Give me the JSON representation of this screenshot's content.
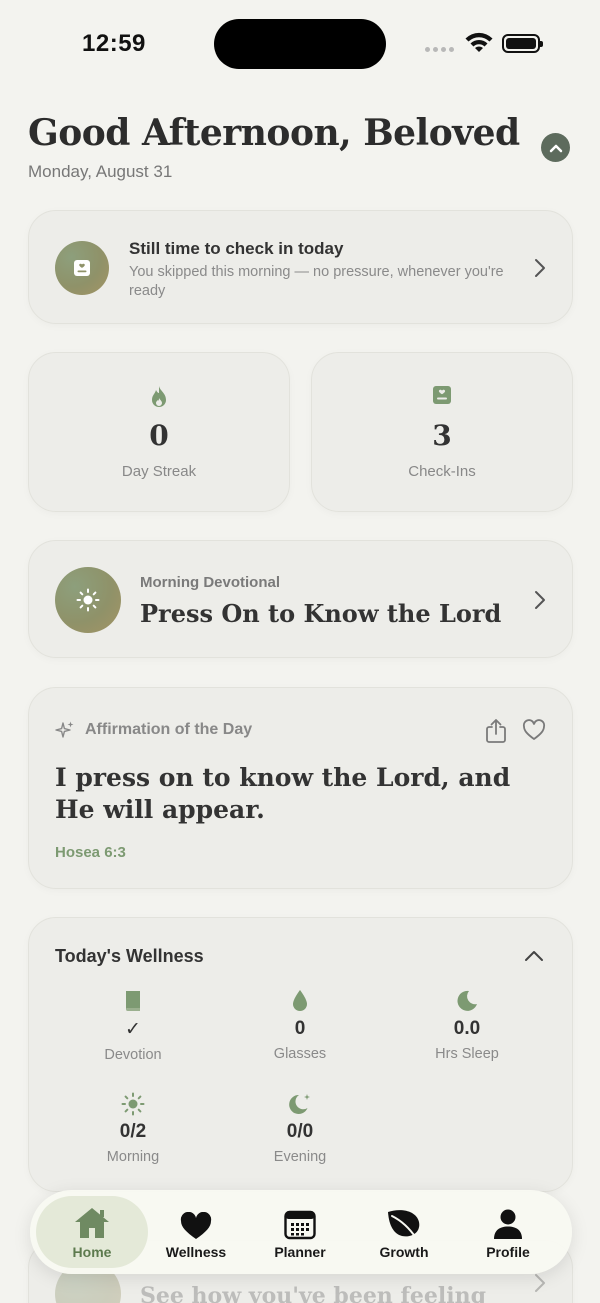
{
  "status_bar": {
    "time": "12:59"
  },
  "header": {
    "greeting": "Good Afternoon, Beloved",
    "date": "Monday, August 31"
  },
  "checkin_card": {
    "title": "Still time to check in today",
    "subtitle": "You skipped this morning — no pressure, whenever you're ready"
  },
  "stats": [
    {
      "value": "0",
      "label": "Day Streak",
      "icon": "flame-icon"
    },
    {
      "value": "3",
      "label": "Check-Ins",
      "icon": "journal-icon"
    }
  ],
  "devotional": {
    "label": "Morning Devotional",
    "title": "Press On to Know the Lord"
  },
  "affirmation": {
    "label": "Affirmation of the Day",
    "text": "I press on to know the Lord, and He will appear.",
    "reference": "Hosea 6:3"
  },
  "wellness": {
    "title": "Today's Wellness",
    "metrics": [
      {
        "value": "✓",
        "label": "Devotion",
        "icon": "book-icon"
      },
      {
        "value": "0",
        "label": "Glasses",
        "icon": "water-drop-icon"
      },
      {
        "value": "0.0",
        "label": "Hrs Sleep",
        "icon": "moon-icon"
      },
      {
        "value": "0/2",
        "label": "Morning",
        "icon": "sun-icon"
      },
      {
        "value": "0/0",
        "label": "Evening",
        "icon": "moon-stars-icon"
      }
    ]
  },
  "peek_card": {
    "text": "See how you've been feeling"
  },
  "tabbar": {
    "tabs": [
      {
        "label": "Home",
        "icon": "home-icon",
        "active": true
      },
      {
        "label": "Wellness",
        "icon": "heart-icon"
      },
      {
        "label": "Planner",
        "icon": "calendar-icon"
      },
      {
        "label": "Growth",
        "icon": "leaf-icon"
      },
      {
        "label": "Profile",
        "icon": "person-icon"
      }
    ]
  },
  "colors": {
    "accent_green": "#7d9a72",
    "background": "#f3f3ef",
    "card": "#ecece8",
    "active_tab": "#e4e9d8"
  }
}
